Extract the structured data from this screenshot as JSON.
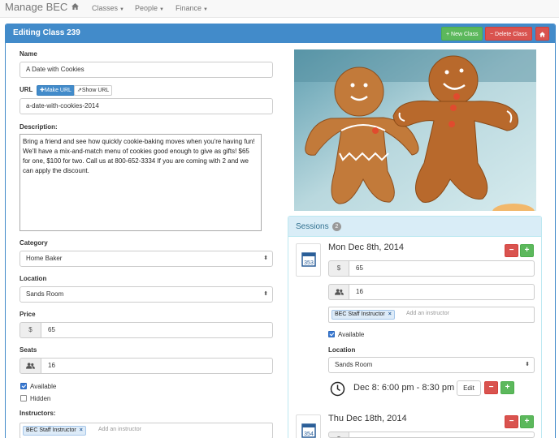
{
  "navbar": {
    "brand": "Manage BEC",
    "home_icon": "home-icon",
    "items": [
      {
        "label": "Classes"
      },
      {
        "label": "People"
      },
      {
        "label": "Finance"
      }
    ]
  },
  "panel": {
    "title": "Editing Class 239",
    "new_class_label": "+ New Class",
    "delete_class_label": "− Delete Class",
    "home_button_icon": "home-icon"
  },
  "form": {
    "name_label": "Name",
    "name_value": "A Date with Cookies",
    "url_label": "URL",
    "make_url_label": "✚Make URL",
    "show_url_label": "⇗Show URL",
    "url_value": "a-date-with-cookies-2014",
    "description_label": "Description:",
    "description_value": "Bring a friend and see how quickly cookie-baking moves when you're having fun! We'll have a mix-and-match menu of cookies good enough to give as gifts! $65 for one, $100 for two. Call us at 800-652-3334 If you are coming with 2 and we can apply the discount.",
    "category_label": "Category",
    "category_value": "Home Baker",
    "location_label": "Location",
    "location_value": "Sands Room",
    "price_label": "Price",
    "price_addon": "$",
    "price_value": "65",
    "seats_label": "Seats",
    "seats_value": "16",
    "available_label": "Available",
    "available_checked": true,
    "hidden_label": "Hidden",
    "hidden_checked": false,
    "instructors_label": "Instructors:",
    "instructor_tag": "BEC Staff Instructor",
    "instructor_placeholder": "Add an instructor"
  },
  "sessions": {
    "title": "Sessions",
    "count": "2",
    "items": [
      {
        "calendar_number": "353",
        "date": "Mon Dec 8th, 2014",
        "price_addon": "$",
        "price": "65",
        "seats": "16",
        "instructor_tag": "BEC Staff Instructor",
        "instructor_placeholder": "Add an instructor",
        "available_label": "Available",
        "available_checked": true,
        "location_label": "Location",
        "location_value": "Sands Room",
        "time": "Dec 8: 6:00 pm - 8:30 pm",
        "edit_label": "Edit"
      },
      {
        "calendar_number": "354",
        "date": "Thu Dec 18th, 2014",
        "price_addon": "$"
      }
    ]
  },
  "colors": {
    "primary": "#428bca",
    "success": "#5cb85c",
    "danger": "#d9534f",
    "info_bg": "#d9edf7"
  }
}
